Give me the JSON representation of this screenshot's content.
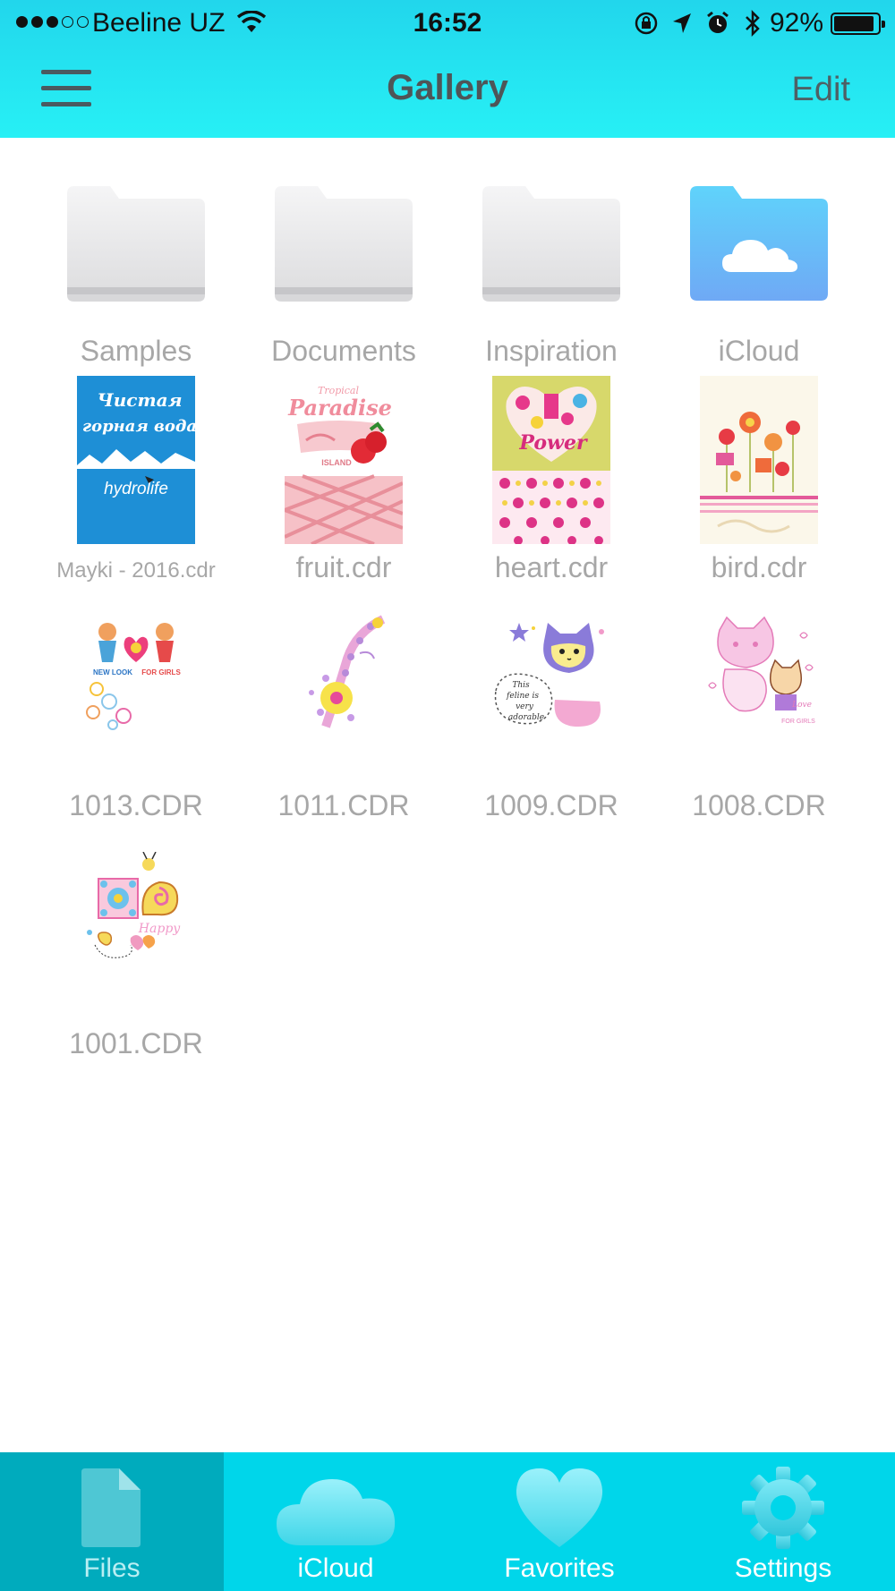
{
  "status_bar": {
    "carrier": "Beeline UZ",
    "time": "16:52",
    "battery": "92%",
    "battery_level": 0.92
  },
  "nav": {
    "title": "Gallery",
    "edit_label": "Edit",
    "menu_icon": "hamburger-icon"
  },
  "folders": [
    {
      "label": "Samples",
      "type": "folder"
    },
    {
      "label": "Documents",
      "type": "folder"
    },
    {
      "label": "Inspiration",
      "type": "folder"
    },
    {
      "label": "iCloud",
      "type": "cloud-folder"
    }
  ],
  "files": [
    {
      "label": "Mayki - 2016.cdr",
      "text": [
        "Чистая",
        "горная вода",
        "hydrolife"
      ]
    },
    {
      "label": "fruit.cdr",
      "text": [
        "Tropical",
        "Paradise",
        "ISLAND"
      ]
    },
    {
      "label": "heart.cdr",
      "text": [
        "Power"
      ]
    },
    {
      "label": "bird.cdr",
      "text": []
    },
    {
      "label": "1013.CDR",
      "text": [
        "NEW LOOK",
        "FOR GIRLS"
      ]
    },
    {
      "label": "1011.CDR",
      "text": []
    },
    {
      "label": "1009.CDR",
      "text": [
        "This",
        "feline is",
        "very",
        "adorable"
      ]
    },
    {
      "label": "1008.CDR",
      "text": [
        "Love",
        "FOR GIRLS"
      ]
    },
    {
      "label": "1001.CDR",
      "text": [
        "Happy"
      ]
    }
  ],
  "tabs": [
    {
      "label": "Files",
      "icon": "file-icon",
      "active": true
    },
    {
      "label": "iCloud",
      "icon": "cloud-icon",
      "active": false
    },
    {
      "label": "Favorites",
      "icon": "heart-icon",
      "active": false
    },
    {
      "label": "Settings",
      "icon": "gear-icon",
      "active": false
    }
  ],
  "colors": {
    "header": "#22d6ec",
    "tab_bar": "#00d6ea",
    "tab_active": "#00abbd",
    "label_gray": "#a7a7a7"
  }
}
